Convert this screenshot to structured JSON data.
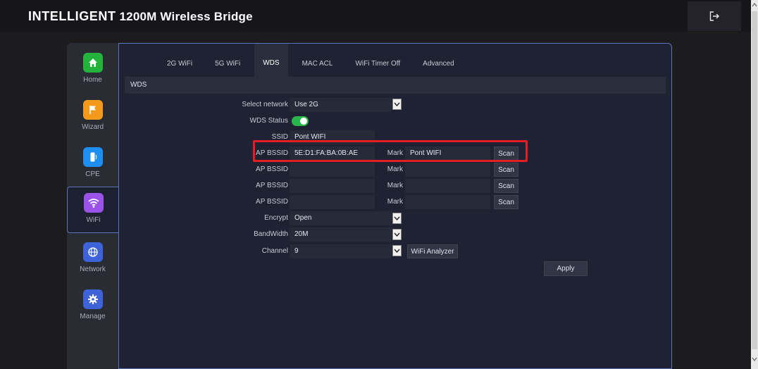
{
  "header": {
    "brand_big": "INTELLIGENT",
    "brand_rest": "1200M Wireless Bridge",
    "logout_icon": "logout-icon"
  },
  "sidebar": {
    "items": [
      {
        "label": "Home",
        "icon": "home-icon",
        "color": "#23b33a"
      },
      {
        "label": "Wizard",
        "icon": "flag-icon",
        "color": "#f39a1c"
      },
      {
        "label": "CPE",
        "icon": "cpe-device-icon",
        "color": "#1e8ff2"
      },
      {
        "label": "WiFi",
        "icon": "wifi-icon",
        "color": "#9b52e8",
        "active": true
      },
      {
        "label": "Network",
        "icon": "globe-icon",
        "color": "#3e63d8"
      },
      {
        "label": "Manage",
        "icon": "gear-icon",
        "color": "#3e63d8"
      }
    ]
  },
  "tabs": [
    {
      "label": "2G WiFi"
    },
    {
      "label": "5G WiFi"
    },
    {
      "label": "WDS",
      "active": true
    },
    {
      "label": "MAC ACL"
    },
    {
      "label": "WiFi Timer Off"
    },
    {
      "label": "Advanced"
    }
  ],
  "section_title": "WDS",
  "form": {
    "select_network_label": "Select network",
    "select_network_value": "Use 2G",
    "wds_status_label": "WDS Status",
    "wds_status_on": true,
    "ssid_label": "SSID",
    "ssid_value": "Pont WIFI",
    "bssid_rows": [
      {
        "label": "AP BSSID",
        "value": "5E:D1:FA:BA:0B:AE",
        "mark_label": "Mark",
        "mark_value": "Pont WIFI",
        "scan_label": "Scan"
      },
      {
        "label": "AP BSSID",
        "value": "",
        "mark_label": "Mark",
        "mark_value": "",
        "scan_label": "Scan"
      },
      {
        "label": "AP BSSID",
        "value": "",
        "mark_label": "Mark",
        "mark_value": "",
        "scan_label": "Scan"
      },
      {
        "label": "AP BSSID",
        "value": "",
        "mark_label": "Mark",
        "mark_value": "",
        "scan_label": "Scan"
      }
    ],
    "encrypt_label": "Encrypt",
    "encrypt_value": "Open",
    "bandwidth_label": "BandWidth",
    "bandwidth_value": "20M",
    "channel_label": "Channel",
    "channel_value": "9",
    "wifi_analyzer_label": "WiFi Analyzer",
    "apply_label": "Apply"
  },
  "colors": {
    "highlight": "#e31e24",
    "toggle_on": "#2ab54b",
    "accent_border": "#5e74b8"
  }
}
